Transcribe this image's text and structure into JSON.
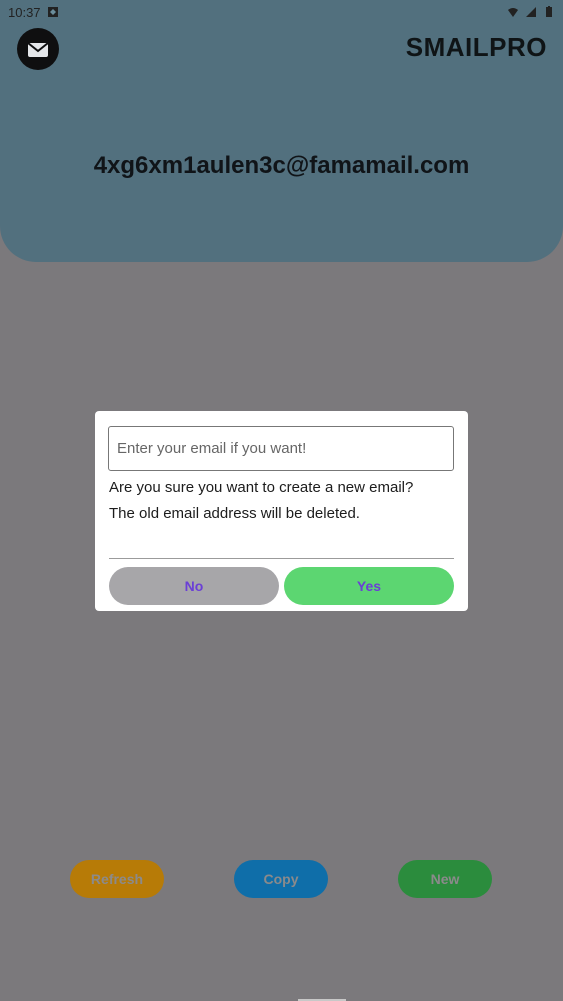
{
  "status_bar": {
    "time": "10:37",
    "left_icon": "notification-box-icon",
    "right_icons": [
      "wifi-icon",
      "signal-icon",
      "battery-icon"
    ]
  },
  "header": {
    "app_title": "SMAILPRO",
    "email": "4xg6xm1aulen3c@famamail.com",
    "logo_icon": "mail-logo-icon",
    "bg_color": "#52707e"
  },
  "dialog": {
    "email_input": {
      "value": "",
      "placeholder": "Enter your email if you want!"
    },
    "message_line1": "Are you sure you want to create a new email?",
    "message_line2": "The old email address will be deleted.",
    "no_label": "No",
    "yes_label": "Yes",
    "colors": {
      "no_bg": "#a7a6a9",
      "yes_bg": "#5cd671",
      "button_text": "#6b3fd6"
    }
  },
  "bottom_actions": {
    "refresh_label": "Refresh",
    "copy_label": "Copy",
    "new_label": "New",
    "colors": {
      "refresh": "#b77b07",
      "copy": "#0f6ea9",
      "new": "#2b8c3d"
    }
  }
}
